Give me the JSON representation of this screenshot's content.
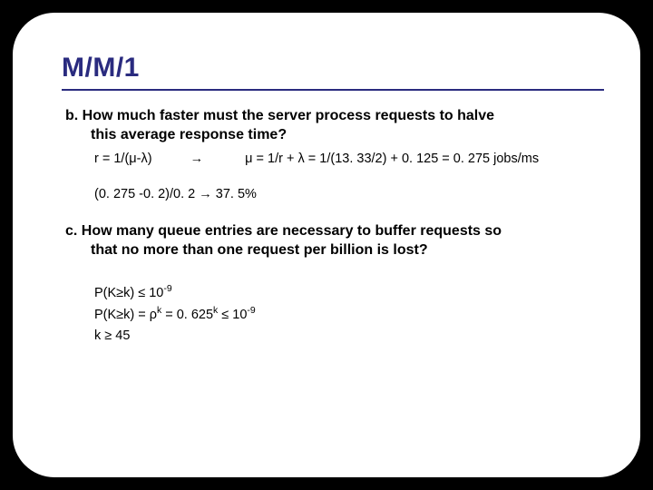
{
  "title": "M/M/1",
  "b": {
    "prompt_l1": "b. How much faster must the server process requests to halve",
    "prompt_l2": "this average response time?",
    "line1_lhs": "r = 1/(μ-λ)",
    "line1_arrow": "→",
    "line1_rhs": "μ = 1/r + λ = 1/(13. 33/2) + 0. 125 = 0. 275 jobs/ms",
    "line2": "(0. 275 -0. 2)/0. 2 →  37. 5%"
  },
  "c": {
    "prompt_l1": "c. How many queue entries are necessary to buffer requests so",
    "prompt_l2": "that no more than one request per billion is lost?",
    "line1_a": "P(K≥k) ≤ 10",
    "line1_exp": "-9",
    "line2_a": "P(K≥k) = ρ",
    "line2_exp1": "k",
    "line2_b": " = 0. 625",
    "line2_exp2": "k",
    "line2_c": " ≤ 10",
    "line2_exp3": "-9",
    "line3": "k ≥ 45"
  }
}
